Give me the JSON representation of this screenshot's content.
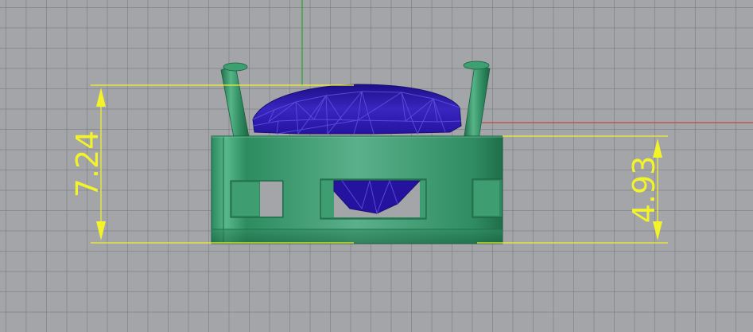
{
  "viewport": {
    "name": "Front",
    "colors": {
      "background": "#a3a5a8",
      "grid": "#7a7c80",
      "x_axis": "#c04848",
      "y_axis": "#35a835",
      "dimension": "#f3f32a",
      "metal": "#2f8f62",
      "gem": "#2a1ba0"
    }
  },
  "dimensions": {
    "overall_height": "7.24",
    "body_height": "4.93"
  }
}
